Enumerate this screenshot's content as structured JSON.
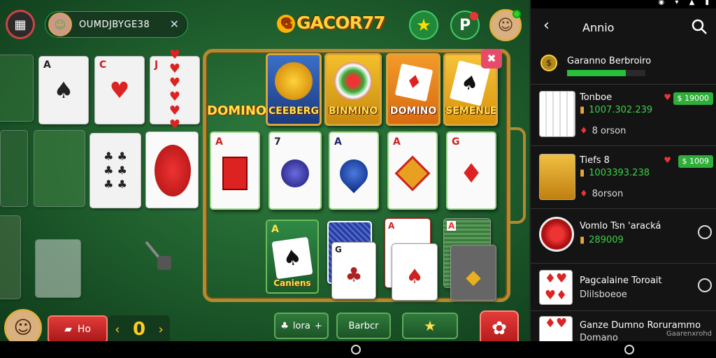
{
  "header": {
    "player_name": "OUMDJBYGE38",
    "logo_text": "GACOR77"
  },
  "tiles": {
    "domino_left": "DOMINO",
    "tile1": "CEEBERG",
    "tile2": "BINMINO",
    "tile3": "DOMINO",
    "tile4": "SEMENLE",
    "tile_bottom": "Caniens"
  },
  "cards": {
    "c1": "A",
    "c2": "C",
    "c3": "J",
    "big1": "A",
    "big2": "7",
    "big3": "A",
    "big4": "A",
    "big5": "G",
    "stack1": "G",
    "stack2": "A",
    "stack3": "A",
    "tile_bottom_rank": "A"
  },
  "bottom_bar": {
    "ho_label": "Ho",
    "counter_value": "0",
    "btn_lora": "lora",
    "btn_barbcr": "Barbcr"
  },
  "panel": {
    "title": "Annio",
    "user_name": "Garanno Berbroiro",
    "user_progress": 0.75,
    "items": [
      {
        "title": "Tonboe",
        "value": "1007.302.239",
        "sub": "8 orson",
        "badge": "$ 19000"
      },
      {
        "title": "Tiefs 8",
        "value": "1003393.238",
        "sub": "8orson",
        "badge": "$ 1009"
      },
      {
        "title": "Vomlo Tsn 'aracká",
        "value": "289009"
      },
      {
        "title": "Pagcalaine Toroait",
        "sub": "Dlilsboeoe"
      },
      {
        "title": "Ganze Dumno Rorurammo",
        "sub": "Domano"
      }
    ],
    "watermark": "Gaarenxrohd"
  },
  "colors": {
    "felt": "#2f7d3f",
    "gold": "#b38a30",
    "accent_red": "#e23a3a",
    "accent_green": "#27c03a"
  }
}
